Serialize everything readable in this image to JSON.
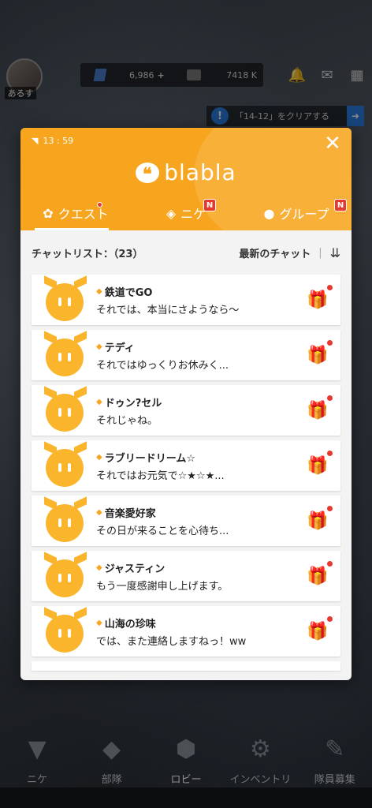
{
  "player": {
    "name": "あるす"
  },
  "resources": {
    "gems": "6,986",
    "gems_plus": "+",
    "credits": "7418 K"
  },
  "mission": {
    "label": "「14-12」をクリアする",
    "icon": "exclaim-icon"
  },
  "status_bar": {
    "time": "13 : 59"
  },
  "app": {
    "logo": "blabla"
  },
  "tabs": [
    {
      "label": "クエスト",
      "icon": "quest-icon",
      "badge": ""
    },
    {
      "label": "ニケ",
      "icon": "nikke-icon",
      "badge": "N"
    },
    {
      "label": "グループ",
      "icon": "group-icon",
      "badge": "N"
    }
  ],
  "list": {
    "count_label": "チャットリスト：（23）",
    "sort_label": "最新のチャット",
    "separator": "|"
  },
  "chats": [
    {
      "name": "鉄道でGO",
      "message": "それでは、本当にさようなら～"
    },
    {
      "name": "テディ",
      "message": "それではゆっくりお休みく..."
    },
    {
      "name": "ドゥン?セル",
      "message": "それじゃね。"
    },
    {
      "name": "ラブリードリーム☆",
      "message": "それではお元気で☆★☆★..."
    },
    {
      "name": "音楽愛好家",
      "message": "その日が来ることを心待ち..."
    },
    {
      "name": "ジャスティン",
      "message": "もう一度感謝申し上げます。"
    },
    {
      "name": "山海の珍味",
      "message": "では、また連絡しますねっ！ww"
    }
  ],
  "bottom_nav": [
    {
      "label": "ニケ",
      "icon": "nikke-nav-icon"
    },
    {
      "label": "部隊",
      "icon": "squad-icon"
    },
    {
      "label": "ロビー",
      "icon": "lobby-icon"
    },
    {
      "label": "インベントリ",
      "icon": "inventory-icon"
    },
    {
      "label": "隊員募集",
      "icon": "recruit-icon"
    }
  ],
  "colors": {
    "accent": "#f7a51e",
    "badge": "#e5392d",
    "avatar": "#fbb52d"
  }
}
